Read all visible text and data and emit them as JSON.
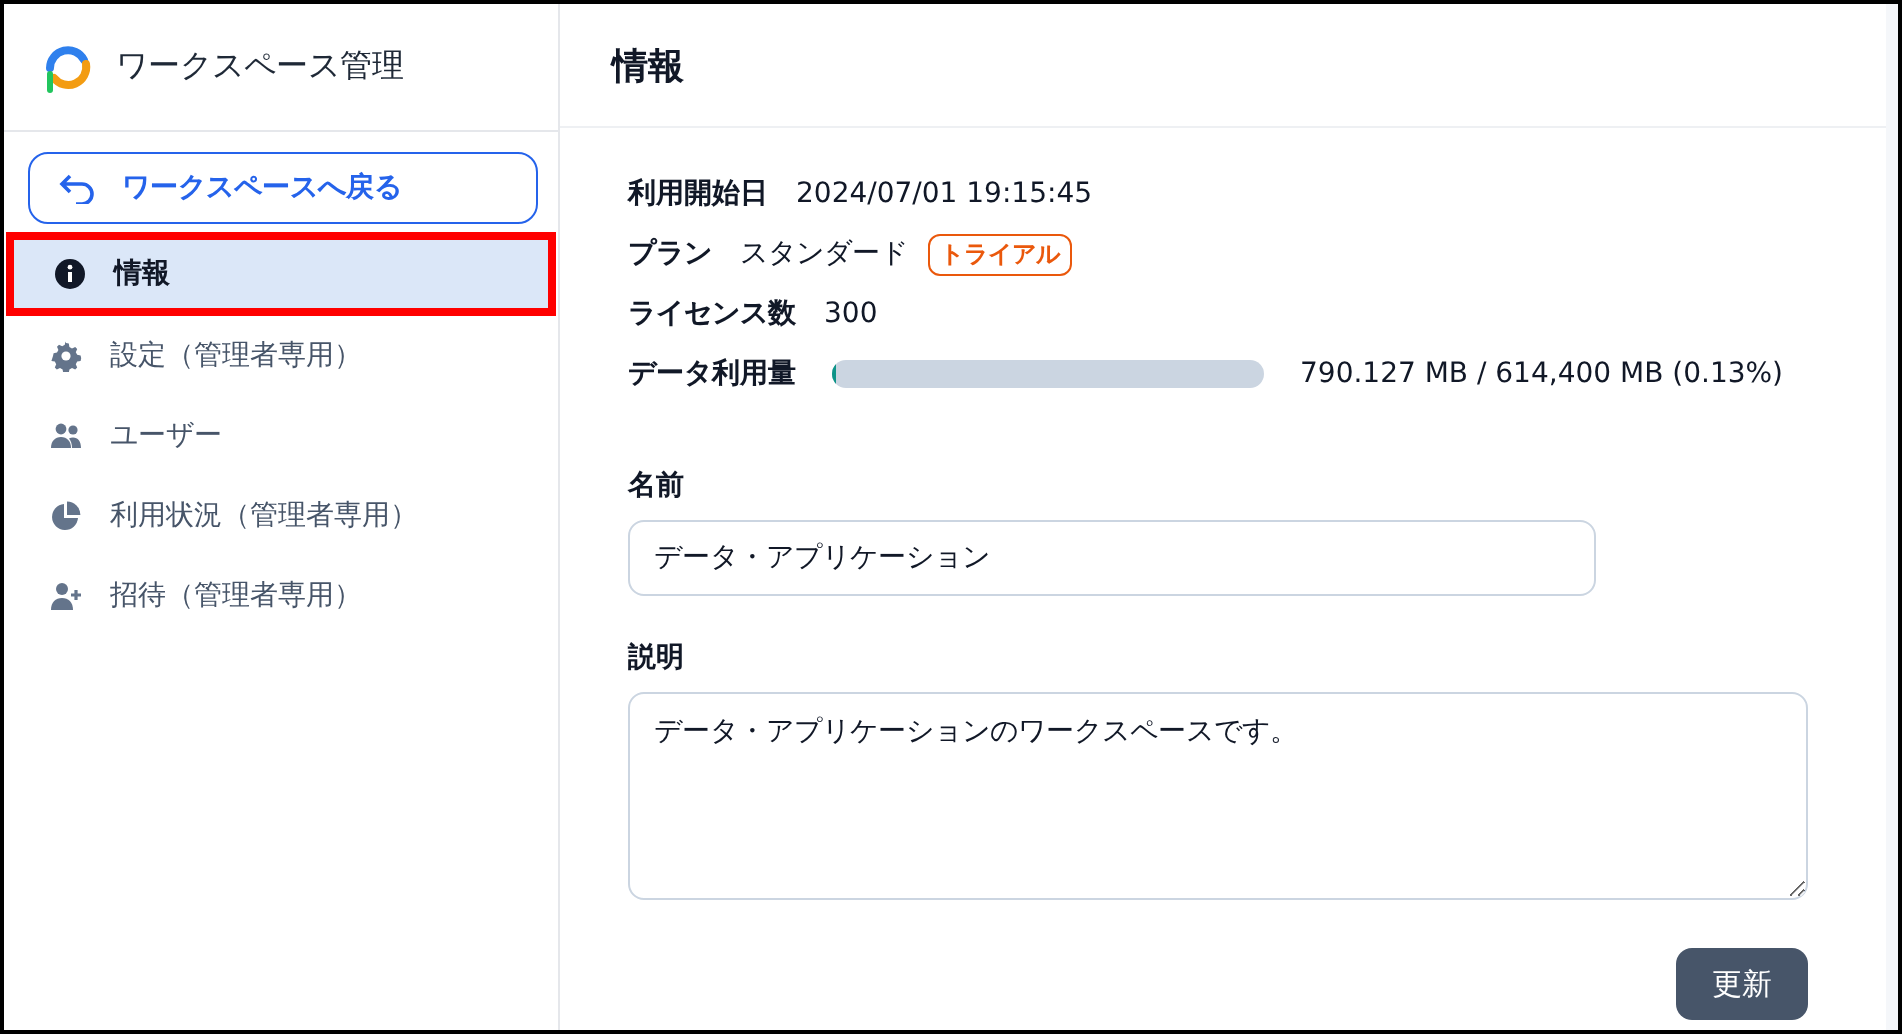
{
  "sidebar": {
    "title": "ワークスペース管理",
    "back_button": "ワークスペースへ戻る",
    "items": [
      {
        "label": "情報",
        "selected": true
      },
      {
        "label": "設定（管理者専用）",
        "selected": false
      },
      {
        "label": "ユーザー",
        "selected": false
      },
      {
        "label": "利用状況（管理者専用）",
        "selected": false
      },
      {
        "label": "招待（管理者専用）",
        "selected": false
      }
    ]
  },
  "main": {
    "title": "情報",
    "info": [
      {
        "kind": "text",
        "label": "利用開始日",
        "value": "2024/07/01 19:15:45"
      },
      {
        "kind": "badge",
        "label": "プラン",
        "value": "スタンダード",
        "badge": "トライアル"
      },
      {
        "kind": "text",
        "label": "ライセンス数",
        "value": "300"
      },
      {
        "kind": "meter",
        "label": "データ利用量",
        "level": 0.0013,
        "value": "790.127 MB / 614,400 MB  (0.13%)"
      }
    ],
    "name_label": "名前",
    "name_value": "データ・アプリケーション",
    "description_label": "説明",
    "description_value": "データ・アプリケーションのワークスペースです。",
    "submit_button": "更新"
  }
}
